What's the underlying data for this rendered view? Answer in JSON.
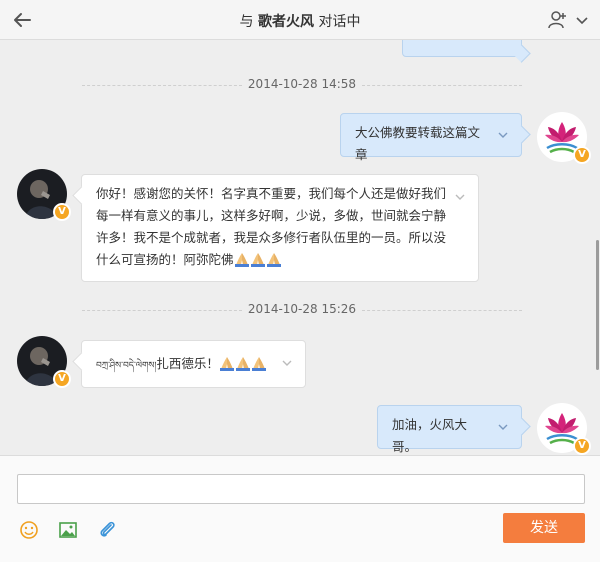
{
  "header": {
    "title_prefix": "与",
    "contact_name": "歌者火风",
    "title_suffix": "对话中"
  },
  "messages": {
    "divider1_time": "2014-10-28 14:58",
    "msg1_text": "大公佛教要转载这篇文章",
    "msg2_text": "你好！感谢您的关怀！名字真不重要，我们每个人还是做好我们每一样有意义的事儿，这样多好啊，少说，多做，世间就会宁静许多！我不是个成就者，我是众多修行者队伍里的一员。所以没什么可宣扬的！阿弥陀佛",
    "divider2_time": "2014-10-28 15:26",
    "msg3_tibetan": "བཀྲ་ཤིས་བདེ་ལེགས།",
    "msg3_text": "扎西德乐！",
    "msg4_text": "加油，火风大哥。"
  },
  "badges": {
    "verified_label": "V"
  },
  "composer": {
    "send_label": "发送",
    "input_value": ""
  },
  "colors": {
    "accent_orange": "#f47d3e",
    "bubble_out_bg": "#d8e9fb",
    "verified_badge": "#f5a623"
  },
  "icons": {
    "back": "arrow-left-icon",
    "add_user": "add-user-icon",
    "menu": "chevron-down-icon",
    "emoji": "smiley-icon",
    "image": "image-icon",
    "attach": "paperclip-icon",
    "pray": "folded-hands-emoji"
  }
}
